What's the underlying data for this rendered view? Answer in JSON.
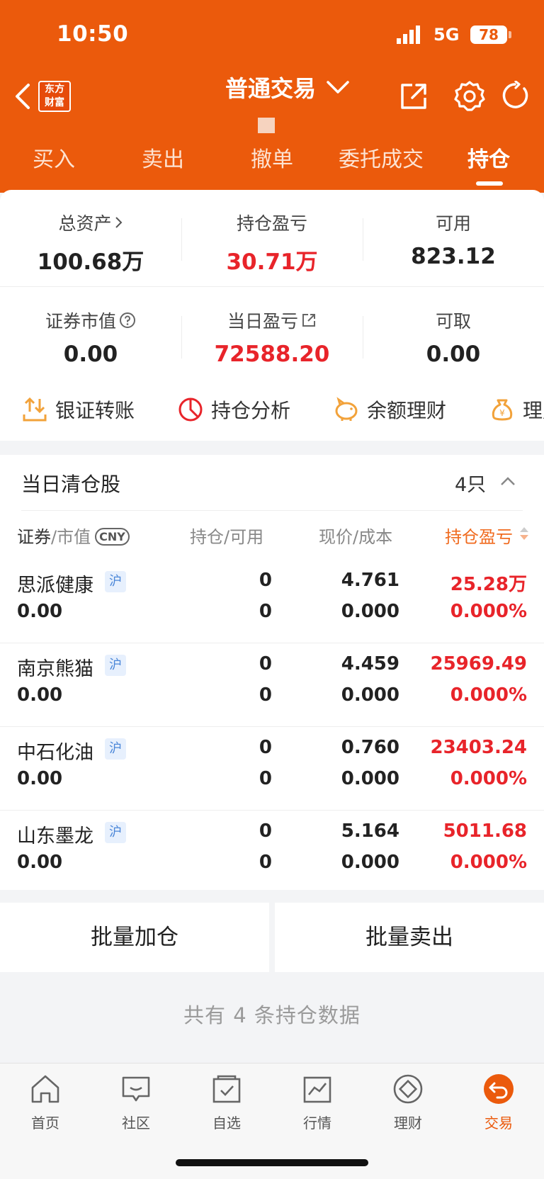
{
  "status_bar": {
    "time": "10:50",
    "network": "5G",
    "battery": "78"
  },
  "nav": {
    "logo_text": "东方\n财富",
    "title": "普通交易"
  },
  "tabs": [
    "买入",
    "卖出",
    "撤单",
    "委托成交",
    "持仓"
  ],
  "active_tab": "持仓",
  "summary": {
    "total_assets": {
      "label": "总资产",
      "value": "100.68万"
    },
    "position_pnl": {
      "label": "持仓盈亏",
      "value": "30.71万"
    },
    "available": {
      "label": "可用",
      "value": "823.12"
    },
    "market_value": {
      "label": "证券市值",
      "value": "0.00"
    },
    "daily_pnl": {
      "label": "当日盈亏",
      "value": "72588.20"
    },
    "withdrawable": {
      "label": "可取",
      "value": "0.00"
    }
  },
  "tools": [
    "银证转账",
    "持仓分析",
    "余额理财",
    "理财"
  ],
  "holdings_section": {
    "title": "当日清仓股",
    "count": "4只",
    "col_security": "证券",
    "col_market_value": "市值",
    "currency": "CNY",
    "col_position": "持仓",
    "col_available": "可用",
    "col_price": "现价",
    "col_cost": "成本",
    "col_pnl": "持仓盈亏",
    "sep": "/"
  },
  "holdings": [
    {
      "name": "思派健康",
      "market": "沪",
      "market_value": "0.00",
      "position": "0",
      "available": "0",
      "price": "4.761",
      "cost": "0.000",
      "pnl": "25.28万",
      "pnl_pct": "0.000%"
    },
    {
      "name": "南京熊猫",
      "market": "沪",
      "market_value": "0.00",
      "position": "0",
      "available": "0",
      "price": "4.459",
      "cost": "0.000",
      "pnl": "25969.49",
      "pnl_pct": "0.000%"
    },
    {
      "name": "中石化油",
      "market": "沪",
      "market_value": "0.00",
      "position": "0",
      "available": "0",
      "price": "0.760",
      "cost": "0.000",
      "pnl": "23403.24",
      "pnl_pct": "0.000%"
    },
    {
      "name": "山东墨龙",
      "market": "沪",
      "market_value": "0.00",
      "position": "0",
      "available": "0",
      "price": "5.164",
      "cost": "0.000",
      "pnl": "5011.68",
      "pnl_pct": "0.000%"
    }
  ],
  "actions": {
    "batch_add": "批量加仓",
    "batch_sell": "批量卖出"
  },
  "footer_note": "共有 4 条持仓数据",
  "tabbar": [
    {
      "label": "首页",
      "icon": "home-icon"
    },
    {
      "label": "社区",
      "icon": "community-icon"
    },
    {
      "label": "自选",
      "icon": "watchlist-icon"
    },
    {
      "label": "行情",
      "icon": "market-icon"
    },
    {
      "label": "理财",
      "icon": "wealth-icon"
    },
    {
      "label": "交易",
      "icon": "trade-icon"
    }
  ],
  "colors": {
    "brand_orange": "#eb5a0c",
    "profit_red": "#e8242a",
    "accent_orange": "#f06a1e"
  }
}
